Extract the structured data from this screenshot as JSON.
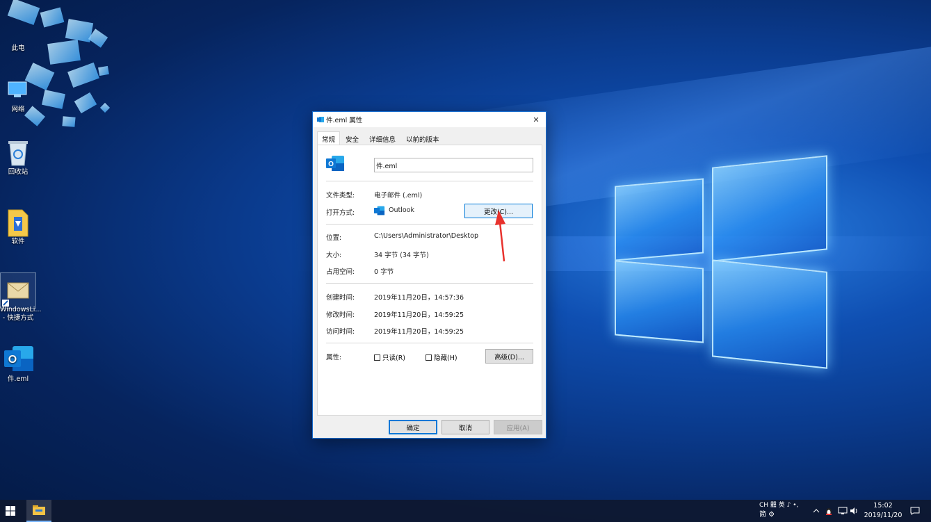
{
  "desktop": {
    "icons": [
      {
        "label": "此电"
      },
      {
        "label": "网络"
      },
      {
        "label": "回收站"
      },
      {
        "label": "软件"
      },
      {
        "label": "WindowsLi...\n- 快捷方式"
      },
      {
        "label": "件.eml"
      }
    ]
  },
  "dialog": {
    "title": "件.eml 属性",
    "close": "✕",
    "tabs": [
      "常规",
      "安全",
      "详细信息",
      "以前的版本"
    ],
    "filename": "件.eml",
    "file_type_label": "文件类型:",
    "file_type_value": "电子邮件 (.eml)",
    "open_with_label": "打开方式:",
    "open_with_value": "Outlook",
    "change_button": "更改(C)...",
    "location_label": "位置:",
    "location_value": "C:\\Users\\Administrator\\Desktop",
    "size_label": "大小:",
    "size_value": "34 字节 (34 字节)",
    "disk_label": "占用空间:",
    "disk_value": "0 字节",
    "created_label": "创建时间:",
    "created_value": "2019年11月20日，14:57:36",
    "modified_label": "修改时间:",
    "modified_value": "2019年11月20日，14:59:25",
    "accessed_label": "访问时间:",
    "accessed_value": "2019年11月20日，14:59:25",
    "attributes_label": "属性:",
    "readonly_label": "只读(R)",
    "hidden_label": "隐藏(H)",
    "advanced_button": "高级(D)...",
    "ok_button": "确定",
    "cancel_button": "取消",
    "apply_button": "应用(A)"
  },
  "taskbar": {
    "ime_top": "CH 䨻 英 ♪ •,",
    "ime_bottom": "简 ⚙",
    "time": "15:02",
    "date": "2019/11/20"
  },
  "colors": {
    "accent": "#0078d7",
    "arrow": "#e8322d"
  }
}
